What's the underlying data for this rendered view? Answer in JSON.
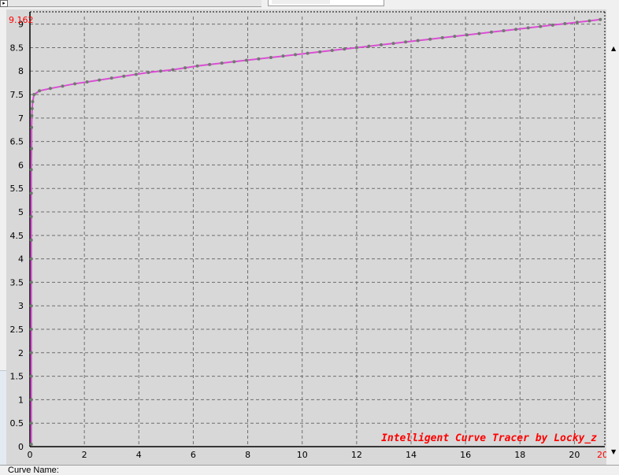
{
  "window": {
    "curve_name_label": "Curve Name:",
    "watermark": "Intelligent Curve Tracer by Locky_z",
    "x_max_marker": "20",
    "y_max_marker": "9.162",
    "top_left_glyph": "▸"
  },
  "colors": {
    "plot_background": "#d8d8d8",
    "grid": "#6e6e6e",
    "curve": "#d94fd3",
    "points": "#6f7a6f",
    "marker_text": "#ff0000",
    "watermark_text": "#ff0000"
  },
  "chart_data": {
    "type": "line",
    "title": "",
    "xlabel": "",
    "ylabel": "",
    "xlim": [
      0,
      21
    ],
    "ylim": [
      0,
      9.162
    ],
    "x_ticks": [
      0,
      2,
      4,
      6,
      8,
      10,
      12,
      14,
      16,
      18,
      20
    ],
    "x_tick_labels": [
      "0",
      "2",
      "4",
      "6",
      "8",
      "10",
      "12",
      "14",
      "16",
      "18",
      "20"
    ],
    "y_ticks": [
      0,
      0.5,
      1,
      1.5,
      2,
      2.5,
      3,
      3.5,
      4,
      4.5,
      5,
      5.5,
      6,
      6.5,
      7,
      7.5,
      8,
      8.5,
      9
    ],
    "y_tick_labels": [
      "0",
      "0.5",
      "1",
      "1.5",
      "2",
      "2.5",
      "3",
      "3.5",
      "4",
      "4.5",
      "5",
      "5.5",
      "6",
      "6.5",
      "7",
      "7.5",
      "8",
      "8.5",
      "9"
    ],
    "grid": true,
    "series": [
      {
        "x": [
          0.05,
          0.05,
          0.05,
          0.05,
          0.05,
          0.05,
          0.05,
          0.05,
          0.05,
          0.05,
          0.05,
          0.05,
          0.05,
          0.06,
          0.06,
          0.07,
          0.08,
          0.1,
          0.15,
          0.35,
          0.75,
          1.2,
          1.65,
          2.1,
          2.55,
          3.0,
          3.45,
          3.9,
          4.35,
          4.8,
          5.25,
          5.7,
          6.15,
          6.6,
          7.05,
          7.5,
          7.95,
          8.4,
          8.85,
          9.3,
          9.75,
          10.2,
          10.65,
          11.1,
          11.55,
          12.0,
          12.45,
          12.9,
          13.35,
          13.8,
          14.25,
          14.7,
          15.15,
          15.6,
          16.05,
          16.5,
          16.95,
          17.4,
          17.85,
          18.3,
          18.75,
          19.2,
          19.65,
          20.1,
          20.55,
          20.95
        ],
        "y": [
          0.05,
          0.5,
          1.0,
          1.5,
          2.0,
          2.5,
          3.0,
          3.5,
          4.0,
          4.4,
          4.9,
          5.4,
          5.9,
          6.35,
          6.8,
          7.05,
          7.2,
          7.35,
          7.5,
          7.58,
          7.63,
          7.68,
          7.73,
          7.77,
          7.81,
          7.85,
          7.89,
          7.93,
          7.97,
          8.0,
          8.03,
          8.07,
          8.11,
          8.14,
          8.17,
          8.2,
          8.23,
          8.26,
          8.29,
          8.32,
          8.35,
          8.38,
          8.41,
          8.44,
          8.47,
          8.5,
          8.53,
          8.56,
          8.59,
          8.62,
          8.65,
          8.68,
          8.71,
          8.74,
          8.77,
          8.8,
          8.83,
          8.86,
          8.89,
          8.92,
          8.95,
          8.98,
          9.01,
          9.04,
          9.07,
          9.1
        ]
      }
    ]
  }
}
